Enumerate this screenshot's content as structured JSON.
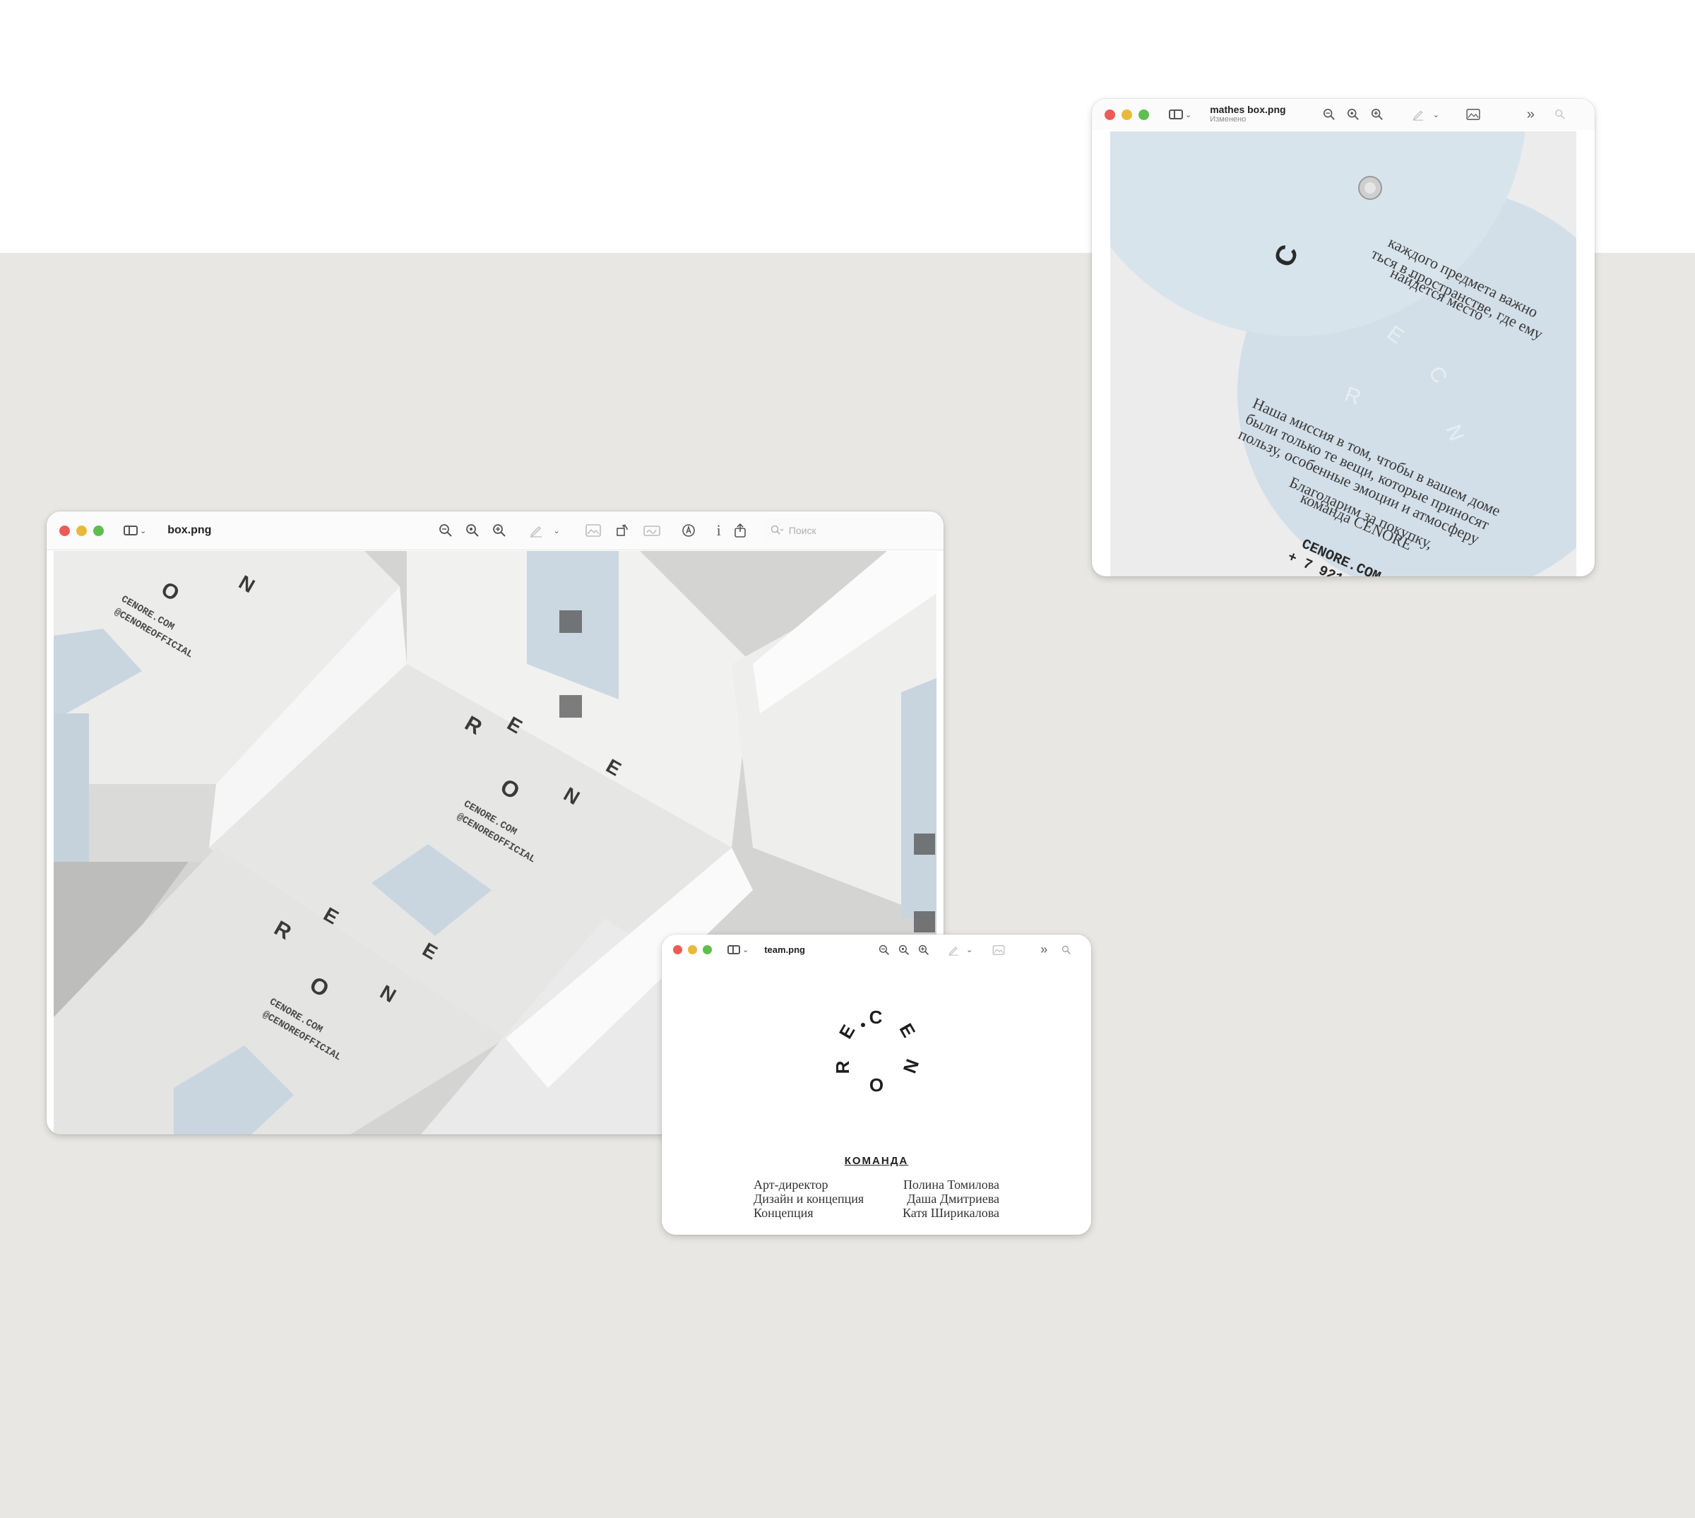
{
  "windows": {
    "box": {
      "title": "box.png",
      "search_placeholder": "Поиск",
      "mockup_text": {
        "url": "CENORE.COM",
        "handle": "@CENOREOFFICIAL"
      }
    },
    "mathes": {
      "title": "mathes box.png",
      "subtitle": "Изменено",
      "card_top_text": [
        "каждого предмета важно",
        "ться в пространстве, где ему",
        "найдется место"
      ],
      "card_letter": "C",
      "card_body": [
        "Наша миссия в том, чтобы в вашем доме",
        "были только те вещи, которые приносят",
        "пользу, особенные эмоции и атмосферу"
      ],
      "card_thanks": [
        "Благодарим за покупку,",
        "команда CENORE"
      ],
      "card_footer": [
        "CENORE.COM",
        "+ 7 921"
      ]
    },
    "team": {
      "title": "team.png",
      "logo_letters": [
        "C",
        "E",
        "N",
        "O",
        "R",
        "E"
      ],
      "heading": "КОМАНДА",
      "members": [
        {
          "role": "Арт-директор",
          "name": "Полина Томилова"
        },
        {
          "role": "Дизайн и концепция",
          "name": "Даша Дмитриева"
        },
        {
          "role": "Концепция",
          "name": "Катя Ширикалова"
        }
      ]
    }
  },
  "colors": {
    "backdrop": "#e8e7e3",
    "card_blue": "#d6e3ec",
    "box_white": "#efefee"
  }
}
